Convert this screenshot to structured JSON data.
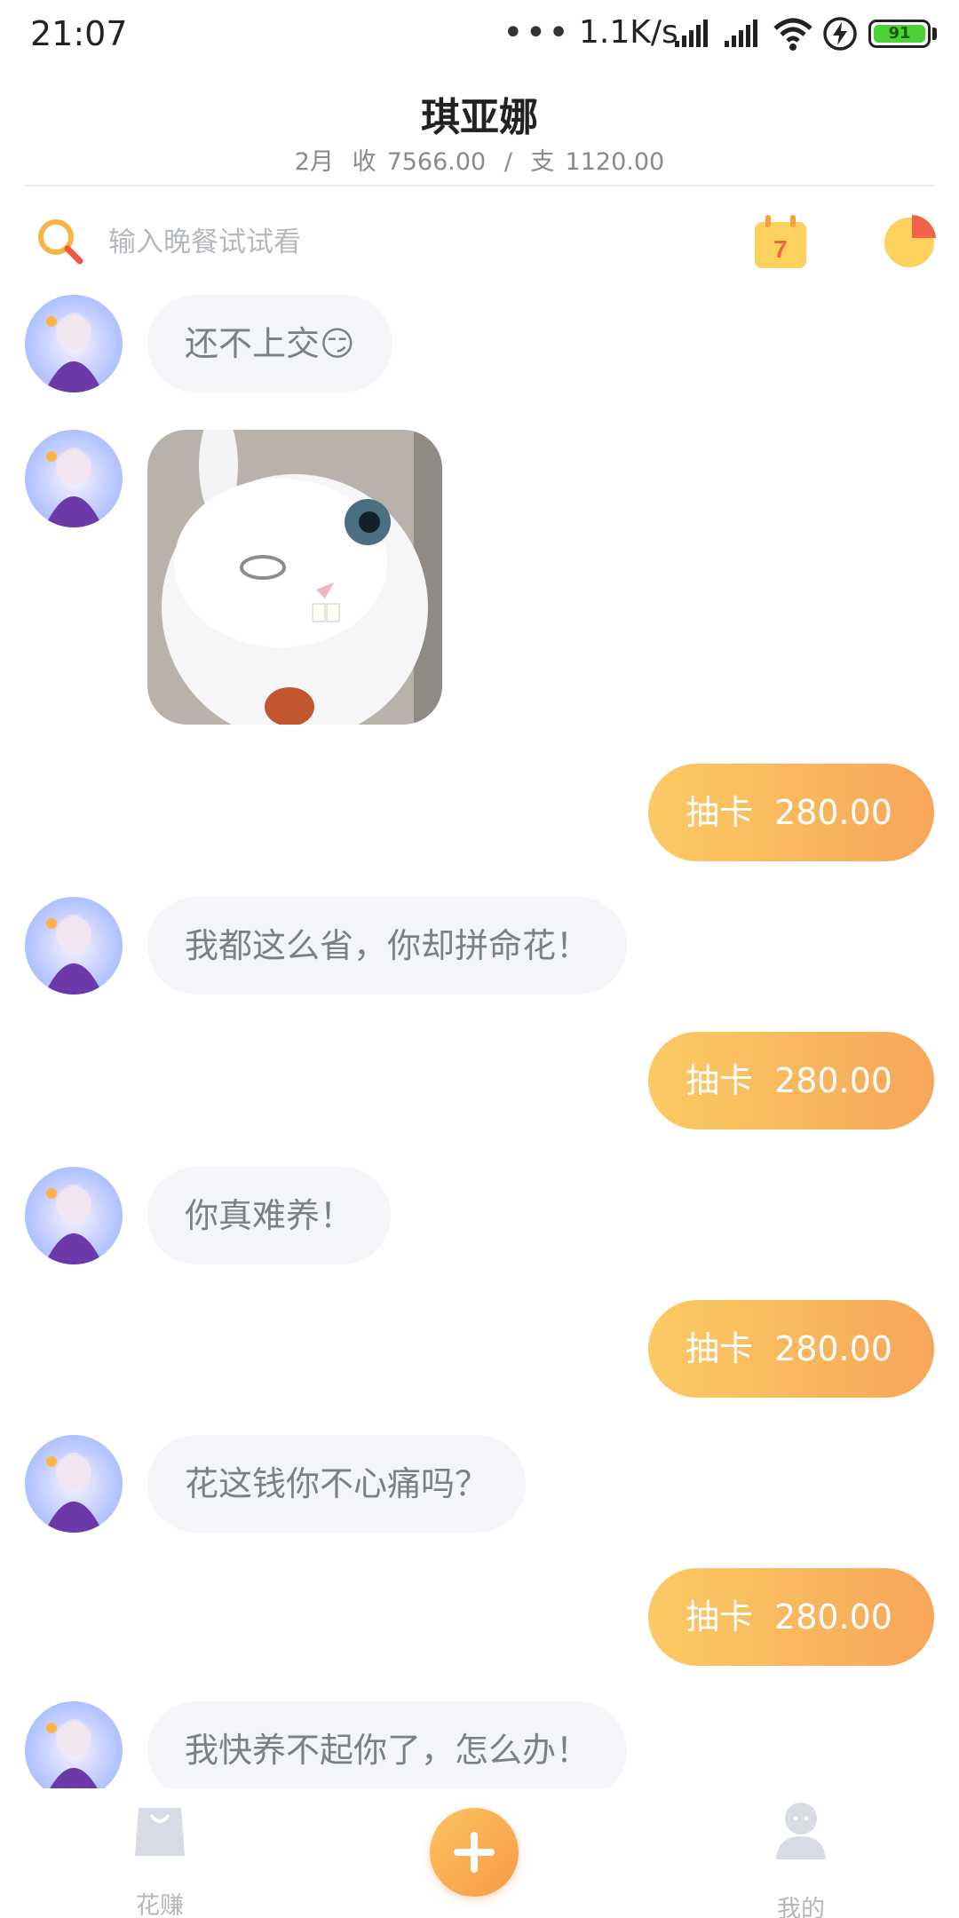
{
  "status_bar": {
    "time": "21:07",
    "dots": "•••",
    "net_speed": "1.1K/s",
    "battery": "91",
    "icons": [
      "signal-icon",
      "signal-icon",
      "wifi-icon",
      "charging-icon",
      "battery-icon"
    ]
  },
  "header": {
    "title": "琪亚娜",
    "month": "2月",
    "income_label": "收",
    "income": "7566.00",
    "separator": "/",
    "expense_label": "支",
    "expense": "1120.00"
  },
  "search": {
    "placeholder": "输入晚餐试试看",
    "value": ""
  },
  "calendar": {
    "day": "7"
  },
  "colors": {
    "accent_start": "#fbcb64",
    "accent_end": "#f7a659",
    "bubble_left": "#f4f5f8",
    "nav_inactive": "#b3b6be"
  },
  "messages": [
    {
      "side": "left",
      "kind": "text",
      "text": "还不上交😏"
    },
    {
      "side": "left",
      "kind": "sticker",
      "icon": "rabbit-sticker"
    },
    {
      "side": "right",
      "kind": "expense",
      "category": "抽卡",
      "amount": "280.00"
    },
    {
      "side": "left",
      "kind": "text",
      "text": "我都这么省，你却拼命花！"
    },
    {
      "side": "right",
      "kind": "expense",
      "category": "抽卡",
      "amount": "280.00"
    },
    {
      "side": "left",
      "kind": "text",
      "text": "你真难养！"
    },
    {
      "side": "right",
      "kind": "expense",
      "category": "抽卡",
      "amount": "280.00"
    },
    {
      "side": "left",
      "kind": "text",
      "text": "花这钱你不心痛吗？"
    },
    {
      "side": "right",
      "kind": "expense",
      "category": "抽卡",
      "amount": "280.00"
    },
    {
      "side": "left",
      "kind": "text",
      "text": "我快养不起你了，怎么办！"
    }
  ],
  "bottom_nav": {
    "items": [
      {
        "label": "花赚",
        "icon": "shopping-bag-icon"
      },
      {
        "label": "",
        "icon": "plus-icon"
      },
      {
        "label": "我的",
        "icon": "user-icon"
      }
    ]
  }
}
